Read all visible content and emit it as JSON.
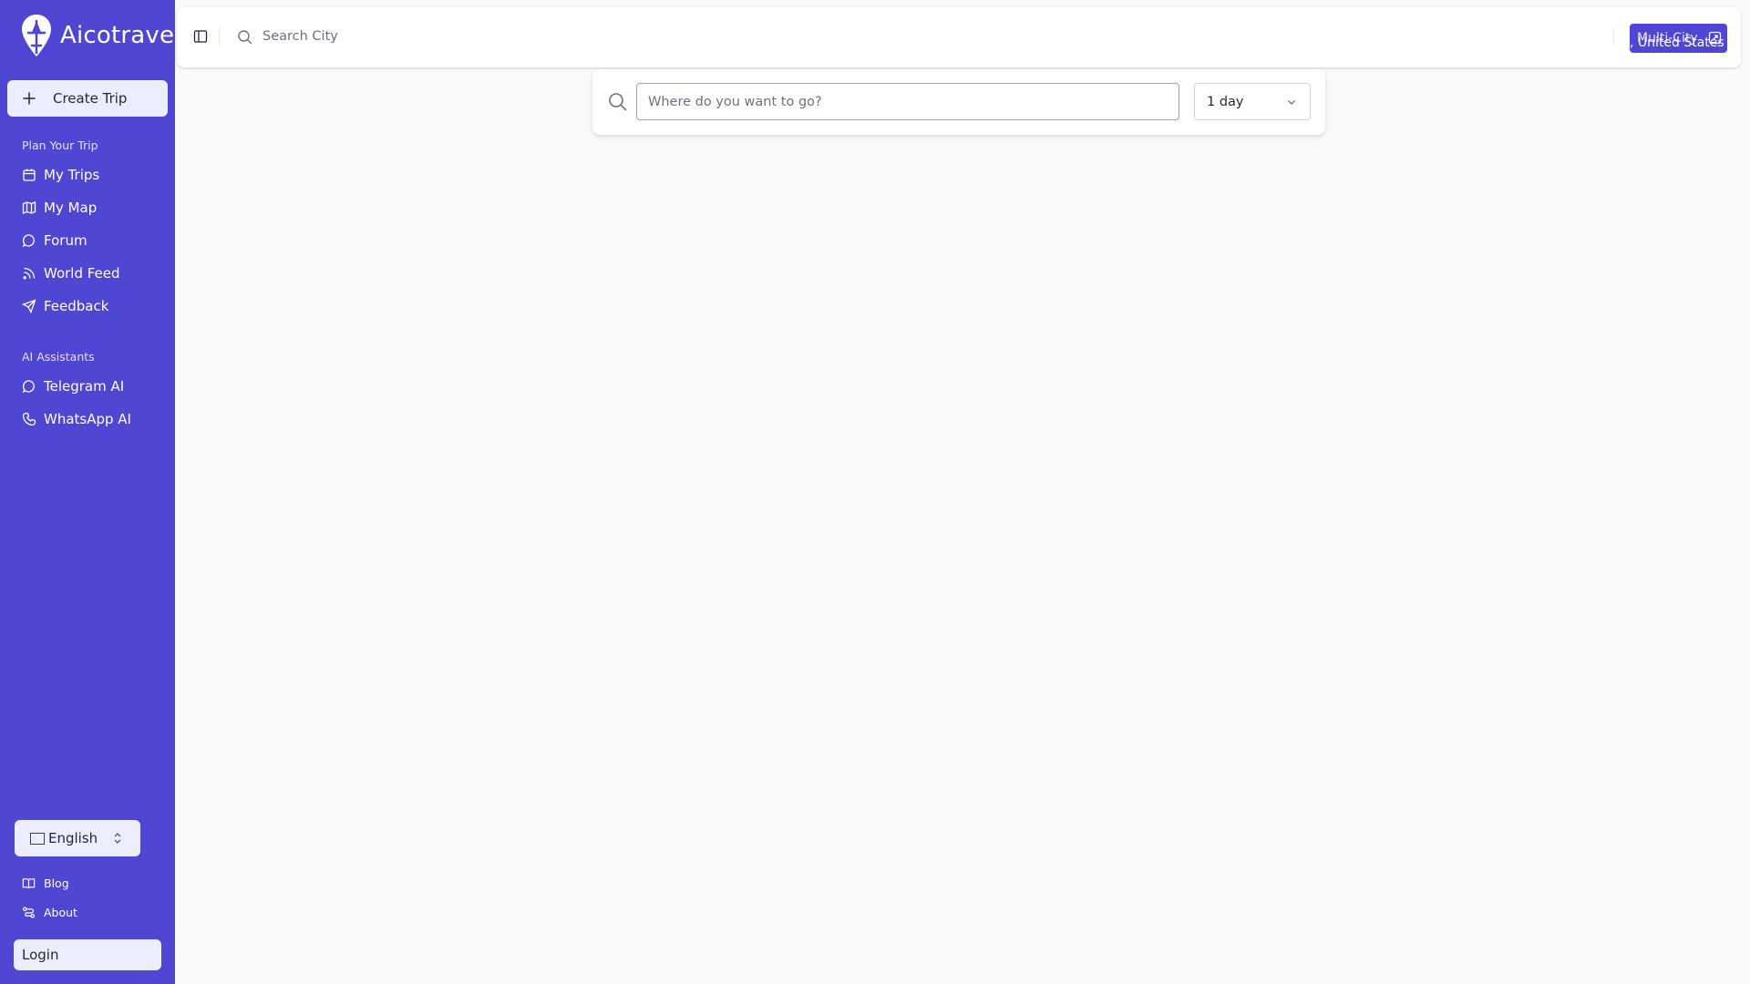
{
  "brand": {
    "name": "Aicotrave"
  },
  "sidebar": {
    "create_trip": "Create Trip",
    "sections": {
      "plan": "Plan Your Trip",
      "ai": "AI Assistants"
    },
    "plan_items": [
      {
        "label": "My Trips",
        "icon": "calendar-icon"
      },
      {
        "label": "My Map",
        "icon": "map-icon"
      },
      {
        "label": "Forum",
        "icon": "message-circle-icon"
      },
      {
        "label": "World Feed",
        "icon": "rss-icon"
      },
      {
        "label": "Feedback",
        "icon": "send-icon"
      }
    ],
    "ai_items": [
      {
        "label": "Telegram AI",
        "icon": "message-circle-icon"
      },
      {
        "label": "WhatsApp AI",
        "icon": "phone-icon"
      }
    ],
    "language": {
      "label": "English"
    },
    "footer_links": [
      {
        "label": "Blog",
        "icon": "book-open-icon"
      },
      {
        "label": "About",
        "icon": "route-icon"
      }
    ],
    "login": "Login"
  },
  "header": {
    "search_placeholder": "Search City",
    "multi_city": "Multi-City",
    "location": ", United States"
  },
  "search_panel": {
    "placeholder": "Where do you want to go?",
    "duration": "1 day"
  },
  "colors": {
    "sidebar_bg": "#5046d4",
    "accent": "#5046d4",
    "button_bg": "#eceefe",
    "page_bg": "#fafafa"
  }
}
